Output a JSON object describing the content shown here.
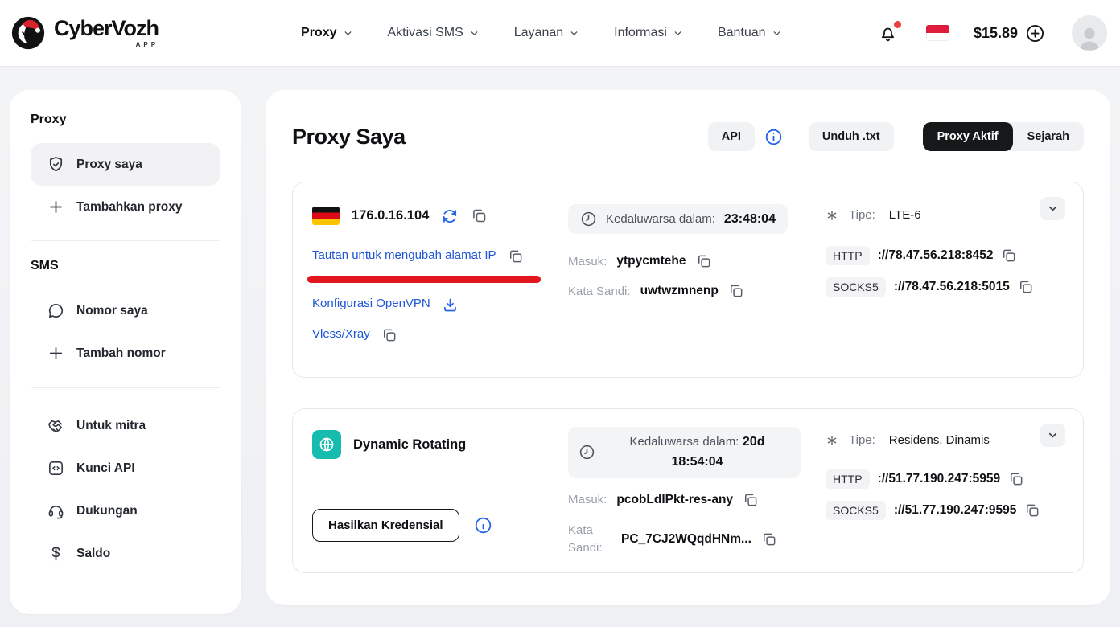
{
  "header": {
    "brand": "CyberVozh",
    "brand_sub": "APP",
    "nav": [
      {
        "label": "Proxy"
      },
      {
        "label": "Aktivasi SMS"
      },
      {
        "label": "Layanan"
      },
      {
        "label": "Informasi"
      },
      {
        "label": "Bantuan"
      }
    ],
    "balance": "$15.89"
  },
  "sidebar": {
    "proxy_section": {
      "title": "Proxy",
      "items": [
        {
          "label": "Proxy saya",
          "icon": "shield-check-icon",
          "active": true
        },
        {
          "label": "Tambahkan proxy",
          "icon": "plus-icon"
        }
      ]
    },
    "sms_section": {
      "title": "SMS",
      "items": [
        {
          "label": "Nomor saya",
          "icon": "chat-icon"
        },
        {
          "label": "Tambah nomor",
          "icon": "plus-icon"
        }
      ]
    },
    "misc_items": [
      {
        "label": "Untuk mitra",
        "icon": "handshake-icon"
      },
      {
        "label": "Kunci API",
        "icon": "api-key-icon"
      },
      {
        "label": "Dukungan",
        "icon": "headset-icon"
      },
      {
        "label": "Saldo",
        "icon": "dollar-icon"
      }
    ]
  },
  "main": {
    "title": "Proxy Saya",
    "api_button": "API",
    "download_button": "Unduh .txt",
    "tabs": [
      {
        "label": "Proxy Aktif",
        "active": true
      },
      {
        "label": "Sejarah"
      }
    ],
    "cards": [
      {
        "country": "germany",
        "ip": "176.0.16.104",
        "expiry_label": "Kedaluwarsa dalam:",
        "expiry_value": "23:48:04",
        "type_label": "Tipe:",
        "type_value": "LTE-6",
        "links": {
          "change_ip": "Tautan untuk mengubah alamat IP",
          "openvpn": "Konfigurasi OpenVPN",
          "vless": "Vless/Xray"
        },
        "login_label": "Masuk:",
        "login_value": "ytpycmtehe",
        "password_label": "Kata Sandi:",
        "password_value": "uwtwzmnenp",
        "endpoints": [
          {
            "protocol": "HTTP",
            "address": "://78.47.56.218:8452"
          },
          {
            "protocol": "SOCKS5",
            "address": "://78.47.56.218:5015"
          }
        ]
      },
      {
        "name": "Dynamic Rotating",
        "expiry_label": "Kedaluwarsa dalam:",
        "expiry_value_line1": "20d",
        "expiry_value_line2": "18:54:04",
        "type_label": "Tipe:",
        "type_value": "Residens. Dinamis",
        "login_label": "Masuk:",
        "login_value": "pcobLdlPkt-res-any",
        "password_label": "Kata Sandi:",
        "password_value": "PC_7CJ2WQqdHNm...",
        "generate_button": "Hasilkan Kredensial",
        "endpoints": [
          {
            "protocol": "HTTP",
            "address": "://51.77.190.247:5959"
          },
          {
            "protocol": "SOCKS5",
            "address": "://51.77.190.247:9595"
          }
        ]
      }
    ]
  },
  "colors": {
    "accent_blue": "#2563eb",
    "link_blue": "#1e56d6",
    "alert_red": "#e3161f",
    "teal": "#16bcae",
    "active_tab_bg": "#17181a",
    "indonesia_flag_red": "#e11d3c",
    "germany_flag": [
      "#111111",
      "#dd0b18",
      "#ffc400"
    ]
  }
}
